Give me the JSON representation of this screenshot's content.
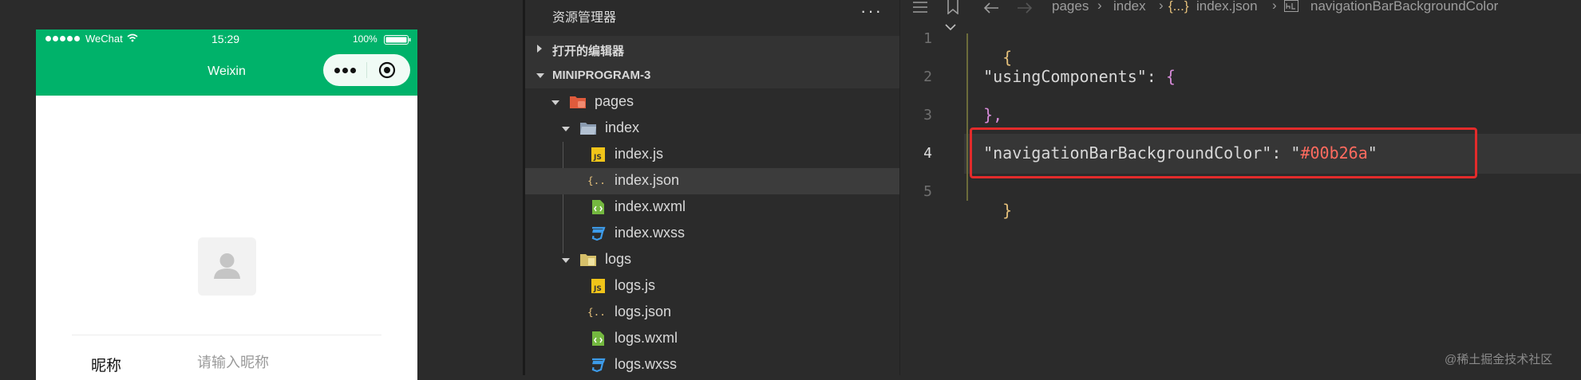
{
  "simulator": {
    "status_bar": {
      "carrier": "WeChat",
      "time": "15:29",
      "battery": "100%"
    },
    "nav_bar": {
      "title": "Weixin",
      "color": "#00b26a"
    },
    "form": {
      "nickname_label": "昵称",
      "nickname_placeholder": "请输入昵称"
    }
  },
  "explorer": {
    "title": "资源管理器",
    "more": "···",
    "sections": [
      {
        "label": "打开的编辑器",
        "expanded": false
      },
      {
        "label": "MINIPROGRAM-3",
        "expanded": true
      }
    ],
    "tree": [
      {
        "label": "pages",
        "type": "folder-pages",
        "expanded": true
      },
      {
        "label": "index",
        "type": "folder",
        "expanded": true
      },
      {
        "label": "index.js",
        "type": "js"
      },
      {
        "label": "index.json",
        "type": "json",
        "selected": true
      },
      {
        "label": "index.wxml",
        "type": "wxml"
      },
      {
        "label": "index.wxss",
        "type": "wxss"
      },
      {
        "label": "logs",
        "type": "folder-logs",
        "expanded": true
      },
      {
        "label": "logs.js",
        "type": "js"
      },
      {
        "label": "logs.json",
        "type": "json"
      },
      {
        "label": "logs.wxml",
        "type": "wxml"
      },
      {
        "label": "logs.wxss",
        "type": "wxss"
      }
    ]
  },
  "editor": {
    "breadcrumb": [
      "pages",
      "index",
      "index.json",
      "navigationBarBackgroundColor"
    ],
    "json_icon_text": "{...}",
    "line_numbers": [
      "1",
      "2",
      "3",
      "4",
      "5"
    ],
    "active_line": 4,
    "lines": {
      "l1_brace": "{",
      "l2_key": "\"usingComponents\"",
      "l2_colon": ": ",
      "l2_brace": "{",
      "l3_close": "},",
      "l4_key": "\"navigationBarBackgroundColor\"",
      "l4_colon": ": ",
      "l4_quote_open": "\"",
      "l4_value": "#00b26a",
      "l4_quote_close": "\"",
      "l5_brace": "}"
    },
    "highlight_color": "#e32b2b"
  },
  "watermark": "@稀土掘金技术社区"
}
